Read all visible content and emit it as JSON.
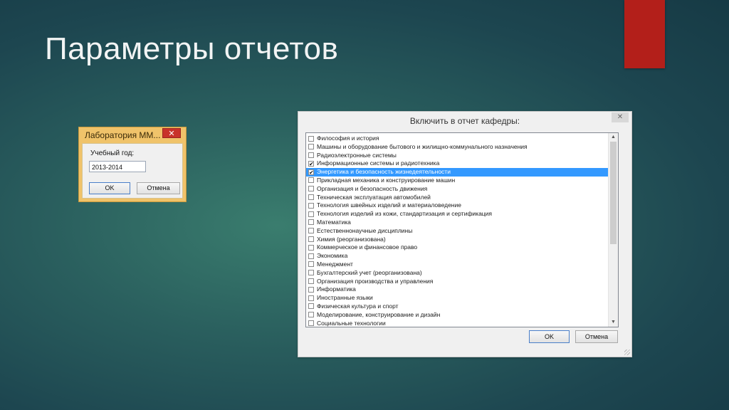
{
  "slide": {
    "title": "Параметры отчетов",
    "accent_color": "#b31f1a"
  },
  "lab_dialog": {
    "title": "Лаборатория ММ...",
    "close_label": "✕",
    "year_label": "Учебный год:",
    "year_value": "2013-2014",
    "ok_label": "OK",
    "cancel_label": "Отмена"
  },
  "report_dialog": {
    "title": "Включить в отчет кафедры:",
    "close_label": "✕",
    "ok_label": "OK",
    "cancel_label": "Отмена",
    "scroll_up_icon": "▲",
    "scroll_down_icon": "▼",
    "items": [
      {
        "label": "Философия и история",
        "checked": false,
        "selected": false
      },
      {
        "label": "Машины и оборудование бытового и жилищно-коммунального назначения",
        "checked": false,
        "selected": false
      },
      {
        "label": "Радиоэлектронные системы",
        "checked": false,
        "selected": false
      },
      {
        "label": "Информационные системы и радиотехника",
        "checked": true,
        "selected": false
      },
      {
        "label": "Энергетика и безопасность жизнедеятельности",
        "checked": true,
        "selected": true
      },
      {
        "label": "Прикладная механика и конструирование машин",
        "checked": false,
        "selected": false
      },
      {
        "label": "Организация и безопасность движения",
        "checked": false,
        "selected": false
      },
      {
        "label": "Техническая эксплуатация автомобилей",
        "checked": false,
        "selected": false
      },
      {
        "label": "Технология швейных изделий и материаловедение",
        "checked": false,
        "selected": false
      },
      {
        "label": "Технология изделий из кожи, стандартизация и сертификация",
        "checked": false,
        "selected": false
      },
      {
        "label": "Математика",
        "checked": false,
        "selected": false
      },
      {
        "label": "Естественнонаучные дисциплины",
        "checked": false,
        "selected": false
      },
      {
        "label": "Химия (реорганизована)",
        "checked": false,
        "selected": false
      },
      {
        "label": "Коммерческое и финансовое право",
        "checked": false,
        "selected": false
      },
      {
        "label": "Экономика",
        "checked": false,
        "selected": false
      },
      {
        "label": "Менеджмент",
        "checked": false,
        "selected": false
      },
      {
        "label": "Бухгалтерский учет (реорганизована)",
        "checked": false,
        "selected": false
      },
      {
        "label": "Организация производства и управления",
        "checked": false,
        "selected": false
      },
      {
        "label": "Информатика",
        "checked": false,
        "selected": false
      },
      {
        "label": "Иностранные языки",
        "checked": false,
        "selected": false
      },
      {
        "label": "Физическая культура и спорт",
        "checked": false,
        "selected": false
      },
      {
        "label": "Моделирование, конструирование и дизайн",
        "checked": false,
        "selected": false
      },
      {
        "label": "Социальные технологии",
        "checked": false,
        "selected": false
      }
    ]
  }
}
